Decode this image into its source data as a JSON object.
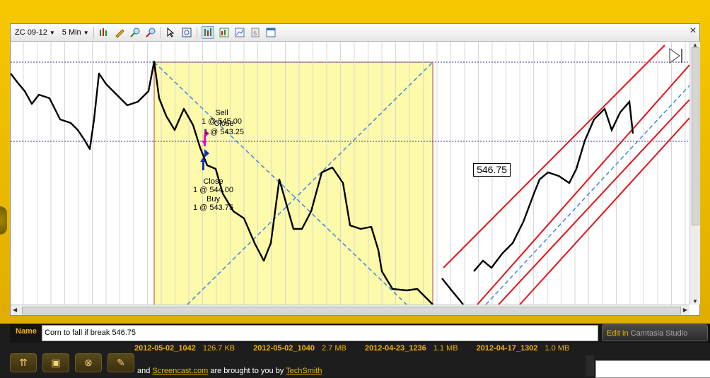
{
  "toolbar": {
    "symbol": "ZC 09-12",
    "interval": "5 Min",
    "icons": [
      "bar-style-icon",
      "pencil-icon",
      "zoom-in-icon",
      "zoom-out-icon",
      "cursor-icon",
      "zoom-box-icon",
      "chart-type-icon",
      "indicators-icon",
      "strategy-icon",
      "properties-icon",
      "template-icon"
    ]
  },
  "chart": {
    "price_label": "546.75",
    "annotations": {
      "sell": "Sell",
      "sell_detail": "1 @ 545.00",
      "close1": "Close",
      "close1_detail": "1 @ 543.25",
      "close2": "Close",
      "close2_detail": "1 @ 544.00",
      "buy": "Buy",
      "buy_detail": "1 @ 543.75"
    },
    "colors": {
      "highlight_zone": "#fdfaaa",
      "channel_line": "#e3141a",
      "dashed_line": "#4a8de0",
      "candle": "#000000",
      "sell_marker": "#e010c0",
      "buy_marker": "#1030c0"
    }
  },
  "bottom": {
    "name_label": "Name",
    "name_value": "Corn to fall if break 546.75",
    "edit_label": "Edit in ",
    "edit_brand": "Camtasia Studio",
    "files": [
      {
        "name": "2012-05-02_1042",
        "size": "126.7 KB"
      },
      {
        "name": "2012-05-02_1040",
        "size": "2.7 MB"
      },
      {
        "name": "2012-04-23_1236",
        "size": "1.1 MB"
      },
      {
        "name": "2012-04-17_1302",
        "size": "1.0 MB"
      }
    ],
    "credits_pre": "and ",
    "credits_link1": "Screencast.com",
    "credits_mid": " are brought to you by ",
    "credits_link2": "TechSmith"
  },
  "accent_color": "#f2b300"
}
